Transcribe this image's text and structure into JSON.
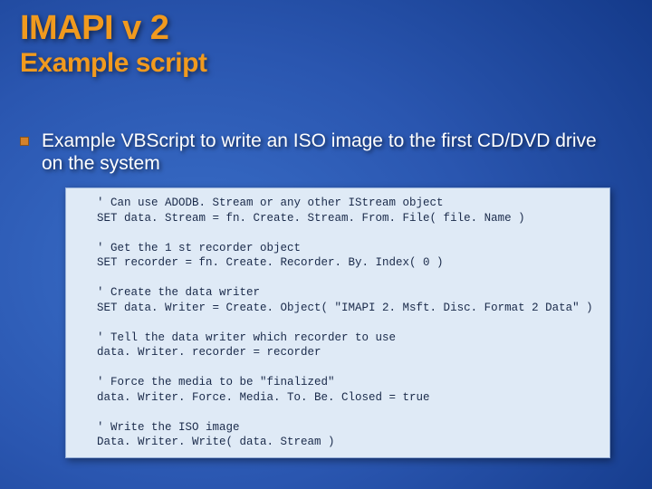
{
  "title": "IMAPI v 2",
  "subtitle": "Example script",
  "bullet_text": "Example VBScript to write an ISO image to the first CD/DVD drive on the system",
  "code": "' Can use ADODB. Stream or any other IStream object\nSET data. Stream = fn. Create. Stream. From. File( file. Name )\n\n' Get the 1 st recorder object\nSET recorder = fn. Create. Recorder. By. Index( 0 )\n\n' Create the data writer\nSET data. Writer = Create. Object( \"IMAPI 2. Msft. Disc. Format 2 Data\" )\n\n' Tell the data writer which recorder to use\ndata. Writer. recorder = recorder\n\n' Force the media to be \"finalized\"\ndata. Writer. Force. Media. To. Be. Closed = true\n\n' Write the ISO image\nData. Writer. Write( data. Stream )"
}
